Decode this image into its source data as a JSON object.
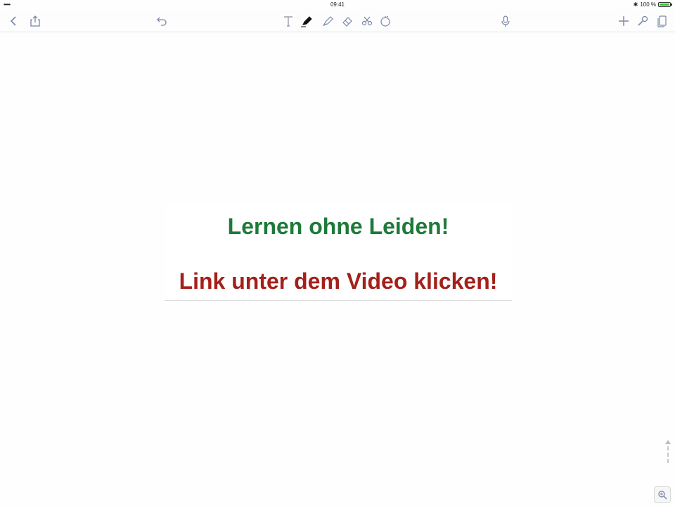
{
  "status_bar": {
    "signal": "•••••",
    "time": "09:41",
    "battery_text": "100 %",
    "battery_level": 1.0
  },
  "toolbar": {
    "left": [
      "back-icon",
      "share-icon",
      "undo-icon"
    ],
    "center": [
      "text-tool-icon",
      "pen-tool-icon",
      "highlighter-tool-icon",
      "eraser-tool-icon",
      "lasso-tool-icon",
      "image-tool-icon"
    ],
    "right": [
      "microphone-icon",
      "add-icon",
      "settings-icon",
      "pages-icon"
    ]
  },
  "document": {
    "headline": "Lernen ohne Leiden!",
    "call_to_action": "Link unter dem Video klicken!"
  },
  "colors": {
    "headline": "#1e7a3a",
    "call_to_action": "#a4201a",
    "icon": "#7a87a8",
    "battery": "#3cbf3c"
  }
}
